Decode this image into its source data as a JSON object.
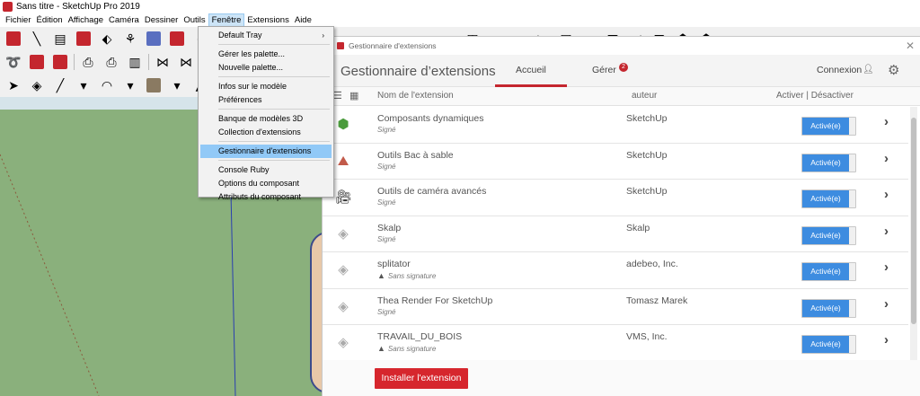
{
  "window": {
    "title": "Sans titre - SketchUp Pro 2019"
  },
  "menubar": {
    "items": [
      "Fichier",
      "Édition",
      "Affichage",
      "Caméra",
      "Dessiner",
      "Outils",
      "Fenêtre",
      "Extensions",
      "Aide"
    ],
    "active": "Fenêtre"
  },
  "dropdown": {
    "items": [
      {
        "label": "Default Tray",
        "has_submenu": true
      },
      {
        "label": "Gérer les palette..."
      },
      {
        "label": "Nouvelle palette..."
      },
      {
        "label": "Infos sur le modèle"
      },
      {
        "label": "Préférences"
      },
      {
        "label": "Banque de modèles 3D"
      },
      {
        "label": "Collection d'extensions"
      },
      {
        "label": "Gestionnaire d'extensions",
        "selected": true
      },
      {
        "label": "Console Ruby"
      },
      {
        "label": "Options du composant"
      },
      {
        "label": "Attributs du composant"
      }
    ],
    "submenu_arrow": "›"
  },
  "ext_window": {
    "window_title": "Gestionnaire d'extensions",
    "title": "Gestionnaire d’extensions",
    "tabs": {
      "home": "Accueil",
      "manage": "Gérer",
      "manage_badge": "2"
    },
    "signin": "Connexion",
    "columns": {
      "name": "Nom de l'extension",
      "author": "auteur",
      "toggle": "Activer | Désactiver"
    },
    "extensions": [
      {
        "name": "Composants dynamiques",
        "status": "Signé",
        "author": "SketchUp",
        "toggle": "Activé(e)",
        "icon": "dynamic-components-icon",
        "signed": true
      },
      {
        "name": "Outils Bac à sable",
        "status": "Signé",
        "author": "SketchUp",
        "toggle": "Activé(e)",
        "icon": "sandbox-icon",
        "signed": true
      },
      {
        "name": "Outils de caméra avancés",
        "status": "Signé",
        "author": "SketchUp",
        "toggle": "Activé(e)",
        "icon": "camera-icon",
        "signed": true
      },
      {
        "name": "Skalp",
        "status": "Signé",
        "author": "Skalp",
        "toggle": "Activé(e)",
        "icon": "extension-icon",
        "signed": true
      },
      {
        "name": "splitator",
        "status": "Sans signature",
        "author": "adebeo, Inc.",
        "toggle": "Activé(e)",
        "icon": "extension-icon",
        "signed": false
      },
      {
        "name": "Thea Render For SketchUp",
        "status": "Signé",
        "author": "Tomasz Marek",
        "toggle": "Activé(e)",
        "icon": "extension-icon",
        "signed": true
      },
      {
        "name": "TRAVAIL_DU_BOIS",
        "status": "Sans signature",
        "author": "VMS, Inc.",
        "toggle": "Activé(e)",
        "icon": "extension-icon",
        "signed": false
      }
    ],
    "install_button": "Installer l'extension"
  },
  "colors": {
    "accent": "#c4262e",
    "toggle_on": "#3d8ce0",
    "menu_highlight": "#91c9f7",
    "ground": "#8ab07c"
  }
}
